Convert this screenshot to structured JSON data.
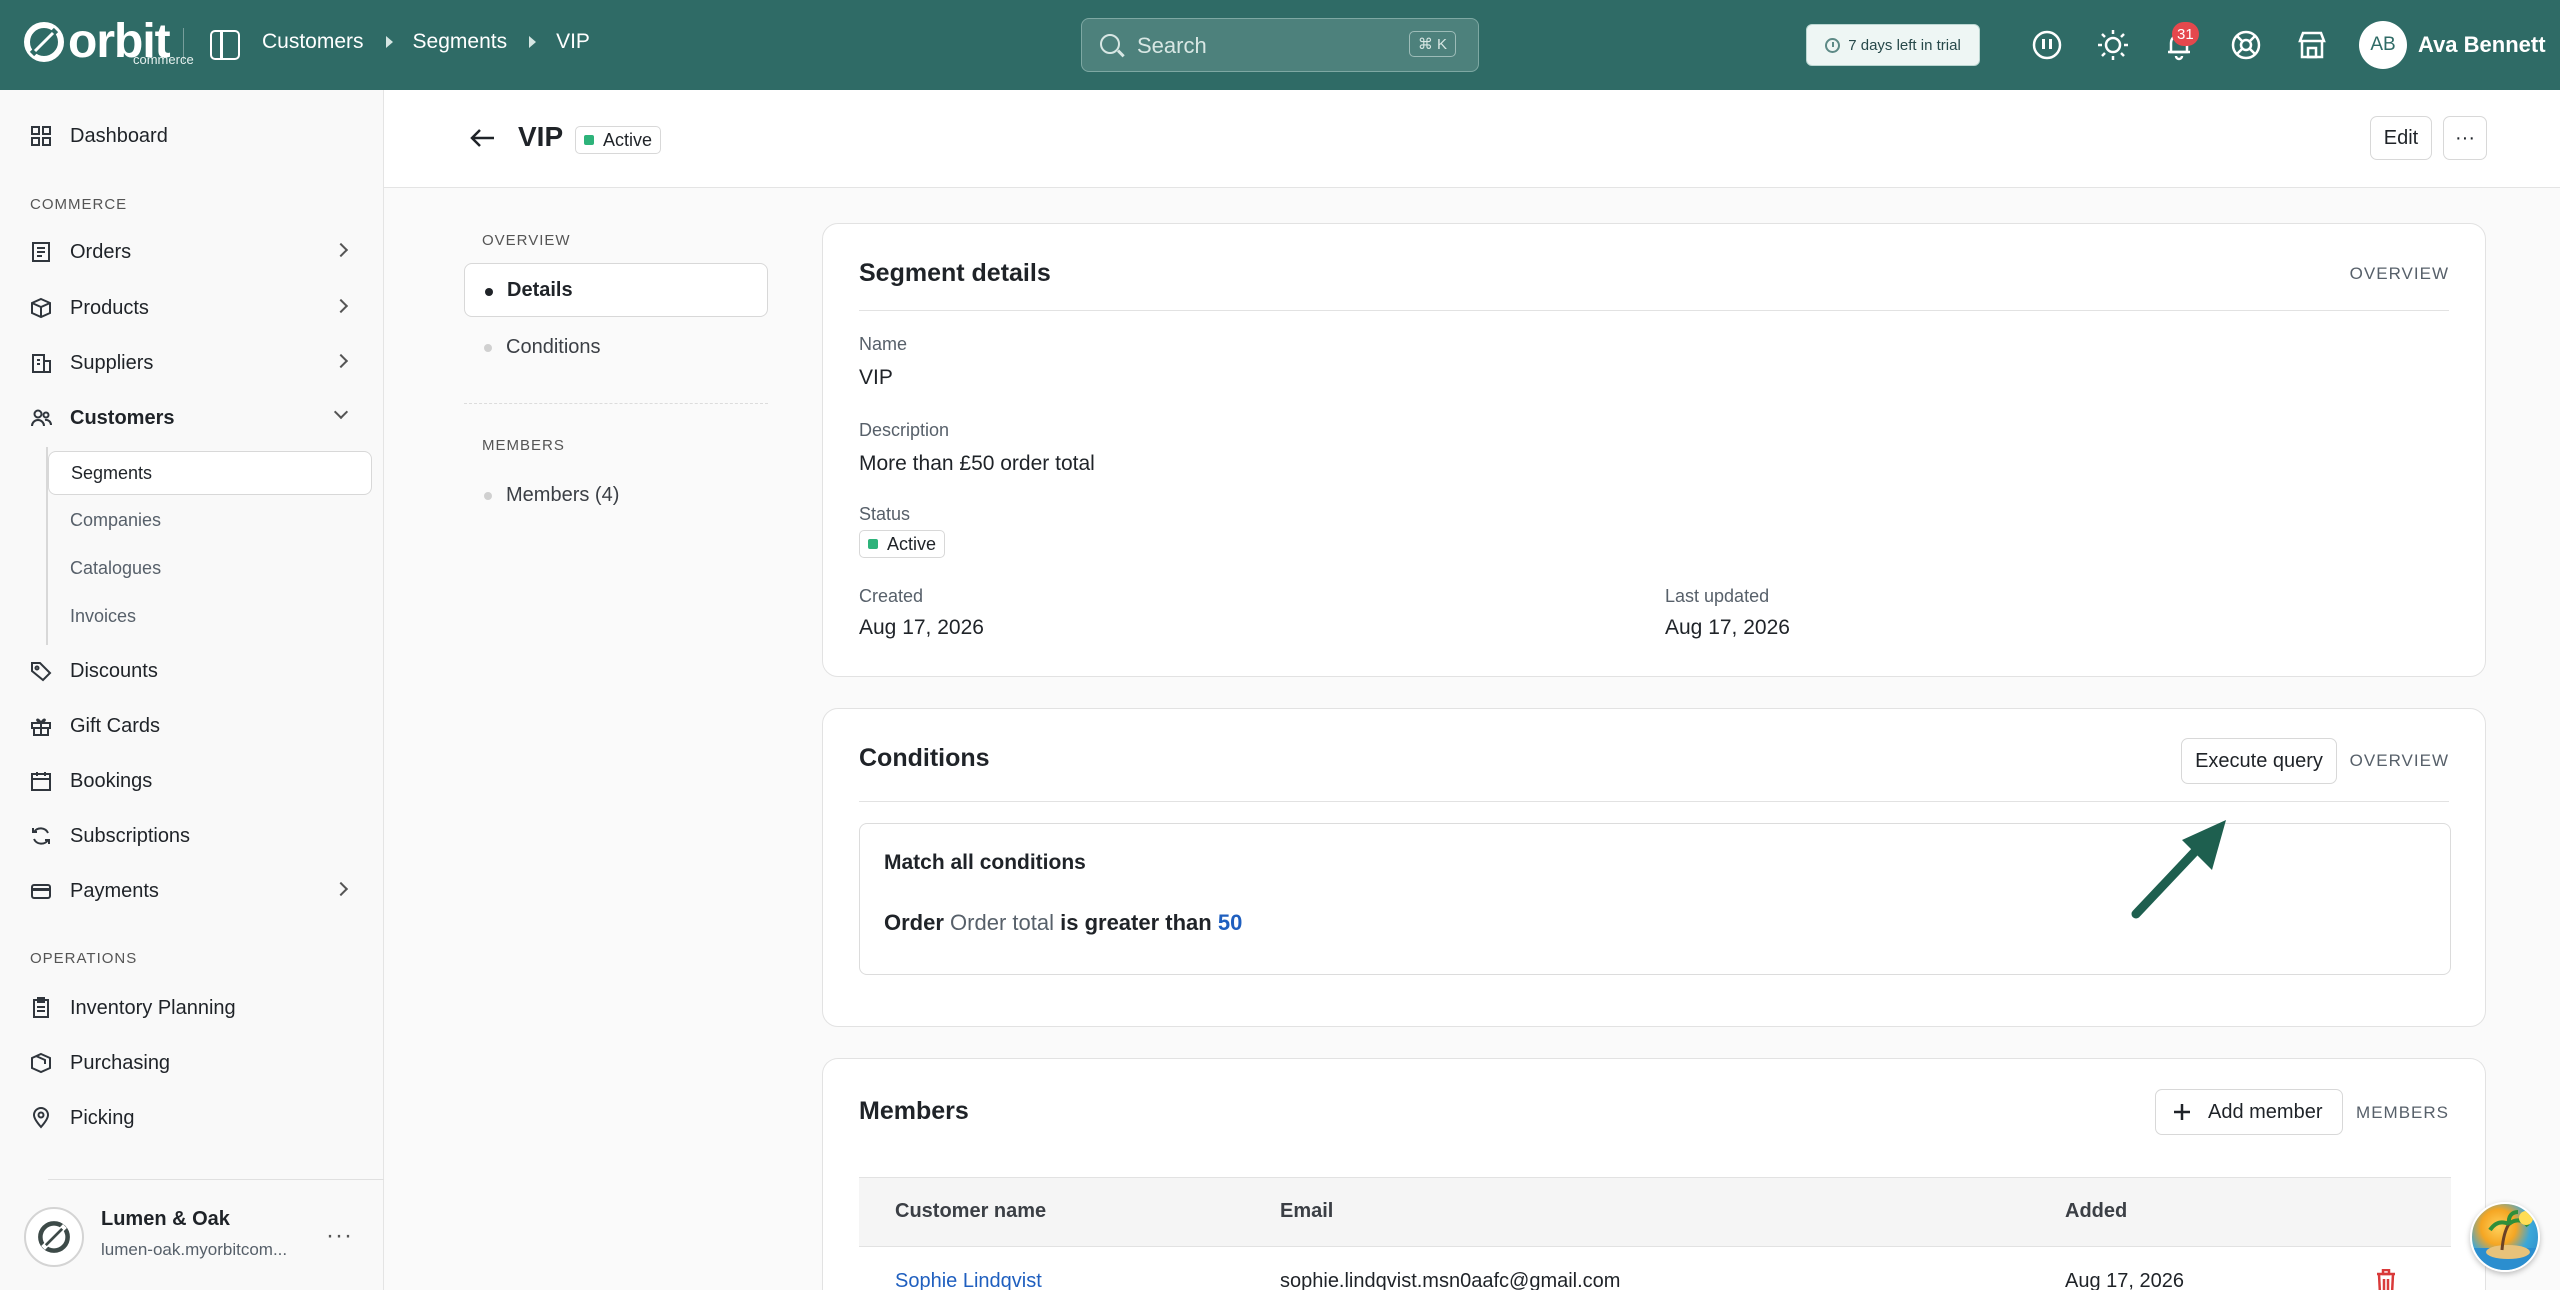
{
  "topbar": {
    "brand": "orbit",
    "brand_sub": "commerce",
    "breadcrumbs": [
      "Customers",
      "Segments",
      "VIP"
    ],
    "search_placeholder": "Search",
    "search_shortcut": "⌘ K",
    "trial_text": "7 days left in trial",
    "notification_count": "31",
    "user_initials": "AB",
    "user_name": "Ava Bennett"
  },
  "sidebar": {
    "dashboard": "Dashboard",
    "commerce_label": "COMMERCE",
    "orders": "Orders",
    "products": "Products",
    "suppliers": "Suppliers",
    "customers": "Customers",
    "customers_sub": [
      "Segments",
      "Companies",
      "Catalogues",
      "Invoices"
    ],
    "discounts": "Discounts",
    "gift_cards": "Gift Cards",
    "bookings": "Bookings",
    "subscriptions": "Subscriptions",
    "payments": "Payments",
    "operations_label": "OPERATIONS",
    "inventory_planning": "Inventory Planning",
    "purchasing": "Purchasing",
    "picking": "Picking",
    "store_name": "Lumen & Oak",
    "store_url": "lumen-oak.myorbitcom..."
  },
  "page": {
    "title": "VIP",
    "status": "Active",
    "edit_label": "Edit",
    "more_label": "···"
  },
  "toc": {
    "overview_label": "OVERVIEW",
    "details": "Details",
    "conditions": "Conditions",
    "members_label": "MEMBERS",
    "members": "Members (4)"
  },
  "details_card": {
    "title": "Segment details",
    "tag": "OVERVIEW",
    "name_label": "Name",
    "name_value": "VIP",
    "description_label": "Description",
    "description_value": "More than £50 order total",
    "status_label": "Status",
    "status_value": "Active",
    "created_label": "Created",
    "created_value": "Aug 17, 2026",
    "updated_label": "Last updated",
    "updated_value": "Aug 17, 2026"
  },
  "conditions_card": {
    "title": "Conditions",
    "execute_label": "Execute query",
    "tag": "OVERVIEW",
    "match_text": "Match all conditions",
    "entity": "Order",
    "attribute": "Order total",
    "operator": "is greater than",
    "value": "50"
  },
  "members_card": {
    "title": "Members",
    "add_label": "Add member",
    "tag": "MEMBERS",
    "columns": [
      "Customer name",
      "Email",
      "Added"
    ],
    "rows": [
      {
        "name": "Sophie Lindqvist",
        "email": "sophie.lindqvist.msn0aafc@gmail.com",
        "added": "Aug 17, 2026"
      }
    ]
  },
  "colors": {
    "topbar": "#2f6b66",
    "accent_link": "#1f5fbf",
    "status_green": "#2db37a",
    "danger": "#d93a3a"
  }
}
